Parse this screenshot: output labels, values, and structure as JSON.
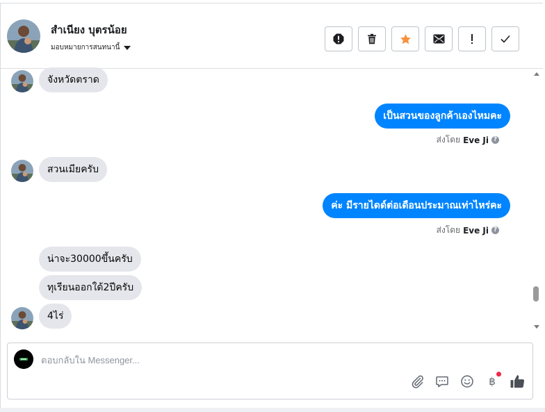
{
  "header": {
    "contact_name": "สำเนียง บุตรน้อย",
    "assign_label": "มอบหมายการสนทนานี้",
    "toolbar": [
      {
        "name": "spam-button",
        "icon": "alert-octagon-icon"
      },
      {
        "name": "delete-button",
        "icon": "trash-icon"
      },
      {
        "name": "star-button",
        "icon": "star-icon"
      },
      {
        "name": "mark-unread-button",
        "icon": "envelope-icon"
      },
      {
        "name": "follow-up-button",
        "icon": "exclamation-icon"
      },
      {
        "name": "done-button",
        "icon": "check-icon"
      }
    ],
    "star_color": "#f7923b"
  },
  "messages": [
    {
      "direction": "in",
      "text": "จังหวัดตราด"
    },
    {
      "direction": "out",
      "text": "เป็นสวนของลูกค้าเองไหมคะ",
      "sent_by_label": "ส่งโดย",
      "sender": "Eve Ji"
    },
    {
      "direction": "in",
      "text": "สวนเมียครับ"
    },
    {
      "direction": "out",
      "text": "ค่ะ มีรายไดด์ต่อเดือนประมาณเท่าไหร่คะ",
      "sent_by_label": "ส่งโดย",
      "sender": "Eve Ji"
    },
    {
      "direction": "in",
      "text": "น่าจะ30000ขึ้นครับ"
    },
    {
      "direction": "in",
      "text": "ทุเรียนออกใด้2ปีครับ"
    },
    {
      "direction": "in",
      "text": "4ไร่"
    }
  ],
  "composer": {
    "placeholder": "ตอบกลับใน Messenger...",
    "value": "",
    "actions": [
      "attachment-icon",
      "saved-reply-icon",
      "emoji-icon",
      "payment-icon",
      "like-icon"
    ],
    "notification_dot_color": "#f02849"
  },
  "colors": {
    "outgoing_bubble": "#0084ff",
    "incoming_bubble": "#e4e6eb"
  }
}
